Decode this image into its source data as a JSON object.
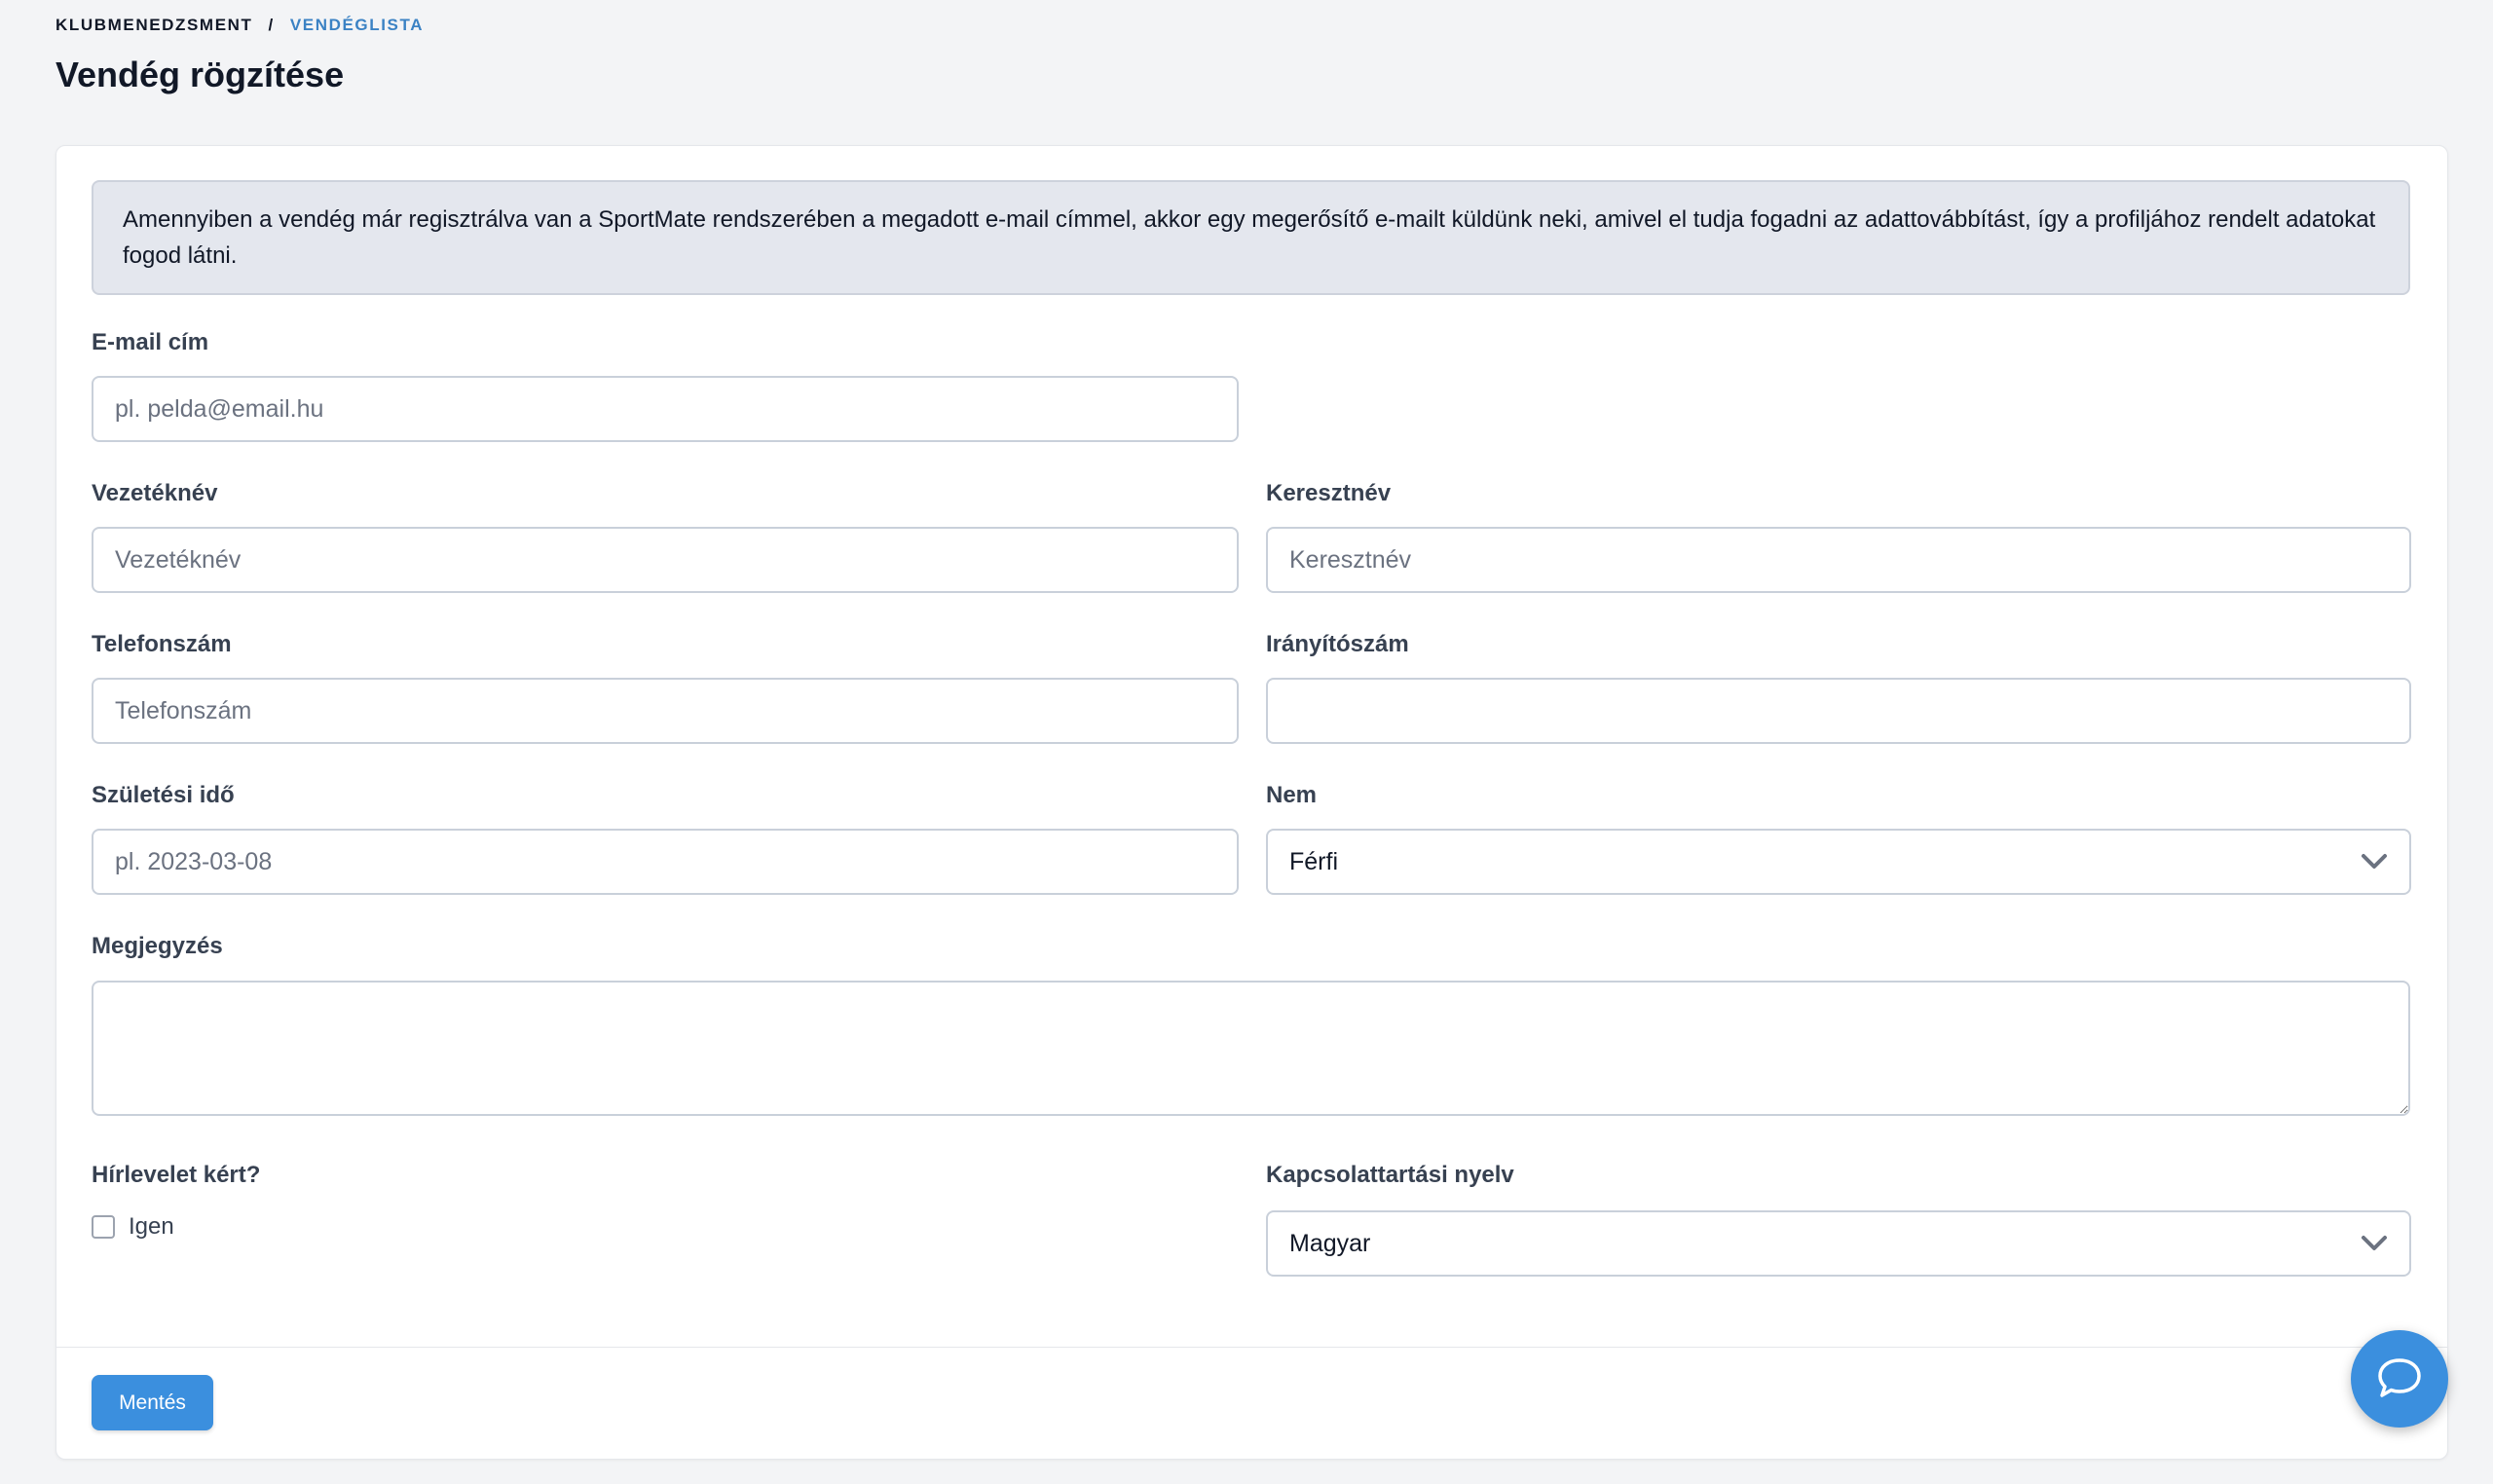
{
  "breadcrumb": {
    "root": "KLUBMENEDZSMENT",
    "separator": "/",
    "current": "VENDÉGLISTA"
  },
  "page": {
    "title": "Vendég rögzítése"
  },
  "notice": {
    "text": "Amennyiben a vendég már regisztrálva van a SportMate rendszerében a megadott e-mail címmel, akkor egy megerősítő e-mailt küldünk neki, amivel el tudja fogadni az adattovábbítást, így a profiljához rendelt adatokat fogod látni."
  },
  "form": {
    "email": {
      "label": "E-mail cím",
      "placeholder": "pl. pelda@email.hu",
      "value": ""
    },
    "last_name": {
      "label": "Vezetéknév",
      "placeholder": "Vezetéknév",
      "value": ""
    },
    "first_name": {
      "label": "Keresztnév",
      "placeholder": "Keresztnév",
      "value": ""
    },
    "phone": {
      "label": "Telefonszám",
      "placeholder": "Telefonszám",
      "value": ""
    },
    "postal_code": {
      "label": "Irányítószám",
      "placeholder": "",
      "value": ""
    },
    "birth_date": {
      "label": "Születési idő",
      "placeholder": "pl. 2023-03-08",
      "value": ""
    },
    "gender": {
      "label": "Nem",
      "selected": "Férfi"
    },
    "note": {
      "label": "Megjegyzés",
      "value": ""
    },
    "newsletter": {
      "label": "Hírlevelet kért?",
      "option_label": "Igen",
      "checked": false
    },
    "language": {
      "label": "Kapcsolattartási nyelv",
      "selected": "Magyar"
    }
  },
  "actions": {
    "save_label": "Mentés"
  },
  "icons": {
    "chat": "chat-bubble-icon",
    "select": "chevron-down-icon"
  },
  "colors": {
    "accent": "#3b8fde",
    "breadcrumb_current": "#3b82c4",
    "notice_bg": "#e4e7ee",
    "page_bg": "#f3f4f6"
  }
}
